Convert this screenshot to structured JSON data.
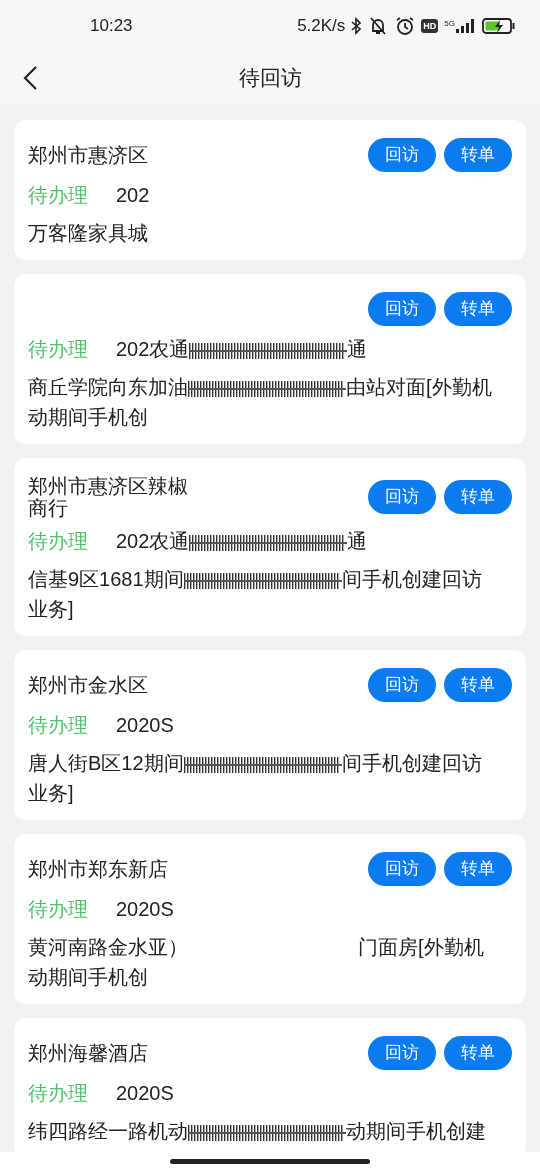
{
  "status_bar": {
    "time": "10:23",
    "speed": "5.2K/s",
    "hd": "HD",
    "network": "5G"
  },
  "header": {
    "title": "待回访"
  },
  "cards": [
    {
      "title": "郑州市惠济区",
      "actions": [
        "回访",
        "转单"
      ],
      "status": "待办理",
      "code": [
        {
          "kind": "text",
          "text": "202"
        }
      ],
      "address": [
        {
          "kind": "text",
          "text": "万客隆家具城"
        }
      ]
    },
    {
      "actions": [
        "回访",
        "转单"
      ],
      "status": "待办理",
      "code": [
        {
          "kind": "text",
          "text": "202农通"
        },
        {
          "kind": "redacted"
        },
        {
          "kind": "text",
          "text": "通"
        }
      ],
      "address": [
        {
          "kind": "text",
          "text": "商丘学院向东加油"
        },
        {
          "kind": "redacted"
        },
        {
          "kind": "text",
          "text": "由站对面[外勤机动期间手机创"
        }
      ]
    },
    {
      "title": "郑州市惠济区辣椒商行",
      "actions": [
        "回访",
        "转单"
      ],
      "status": "待办理",
      "code": [
        {
          "kind": "text",
          "text": "202农通"
        },
        {
          "kind": "redacted"
        },
        {
          "kind": "text",
          "text": "通"
        }
      ],
      "address": [
        {
          "kind": "text",
          "text": "信基9区1681期间"
        },
        {
          "kind": "redacted"
        },
        {
          "kind": "text",
          "text": "间手机创建回访业务]"
        }
      ]
    },
    {
      "title": "郑州市金水区",
      "actions": [
        "回访",
        "转单"
      ],
      "status": "待办理",
      "code": [
        {
          "kind": "text",
          "text": "2020S"
        }
      ],
      "address": [
        {
          "kind": "text",
          "text": "唐人街B区12期间"
        },
        {
          "kind": "redacted"
        },
        {
          "kind": "text",
          "text": "间手机创建回访业务]"
        }
      ]
    },
    {
      "title": "郑州市郑东新店",
      "actions": [
        "回访",
        "转单"
      ],
      "status": "待办理",
      "code": [
        {
          "kind": "text",
          "text": "2020S"
        }
      ],
      "address": [
        {
          "kind": "text",
          "text": "黄河南路金水亚）"
        },
        {
          "kind": "blank"
        },
        {
          "kind": "text",
          "text": "门面房[外勤机动期间手机创"
        }
      ]
    },
    {
      "title": "郑州海馨酒店",
      "actions": [
        "回访",
        "转单"
      ],
      "status": "待办理",
      "code": [
        {
          "kind": "text",
          "text": "2020S"
        }
      ],
      "address": [
        {
          "kind": "text",
          "text": "纬四路经一路机动"
        },
        {
          "kind": "redacted"
        },
        {
          "kind": "text",
          "text": "动期间手机创建"
        }
      ]
    }
  ]
}
